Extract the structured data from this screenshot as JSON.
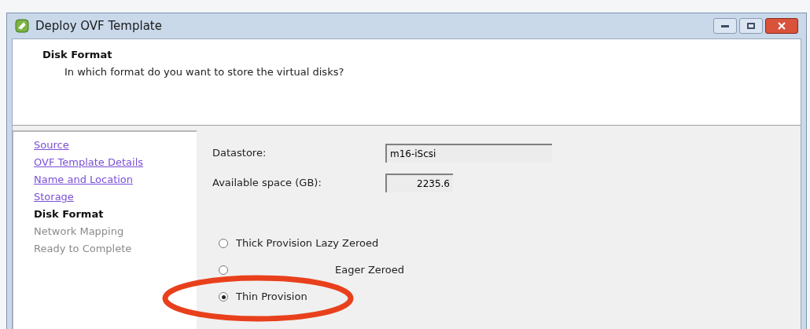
{
  "window": {
    "title": "Deploy OVF Template"
  },
  "header": {
    "title": "Disk Format",
    "subtitle": "In which format do you want to store the virtual disks?"
  },
  "steps": [
    {
      "label": "Source",
      "visited": true,
      "current": false
    },
    {
      "label": "OVF Template Details",
      "visited": true,
      "current": false
    },
    {
      "label": "Name and Location",
      "visited": true,
      "current": false
    },
    {
      "label": "Storage",
      "visited": true,
      "current": false
    },
    {
      "label": "Disk Format",
      "visited": false,
      "current": true
    },
    {
      "label": "Network Mapping",
      "visited": false,
      "current": false
    },
    {
      "label": "Ready to Complete",
      "visited": false,
      "current": false
    }
  ],
  "fields": [
    {
      "label": "Datastore:",
      "value": "m16-iScsi",
      "kind": "wide"
    },
    {
      "label": "Available space (GB):",
      "value": "2235.6",
      "kind": "number"
    }
  ],
  "options": [
    {
      "label": "Thick Provision Lazy Zeroed",
      "selected": false,
      "partly_hidden": false
    },
    {
      "label": "Eager Zeroed",
      "selected": false,
      "partly_hidden": true
    },
    {
      "label": "Thin Provision",
      "selected": true,
      "partly_hidden": false
    }
  ],
  "highlight": {
    "on": true
  }
}
